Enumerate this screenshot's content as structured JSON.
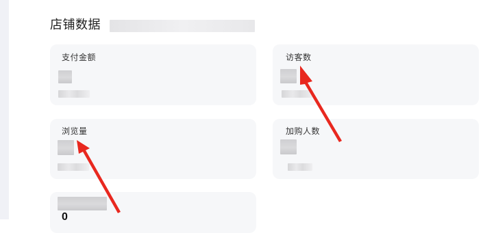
{
  "section": {
    "title": "店铺数据"
  },
  "cards": [
    {
      "label": "支付金额"
    },
    {
      "label": "访客数"
    },
    {
      "label": "浏览量"
    },
    {
      "label": "加购人数"
    }
  ],
  "partial_card": {
    "value_fragment": "0"
  },
  "colors": {
    "card_background": "#f6f7f9",
    "annotation_arrow": "#e8281f",
    "side_strip": "#f0f1f6"
  }
}
